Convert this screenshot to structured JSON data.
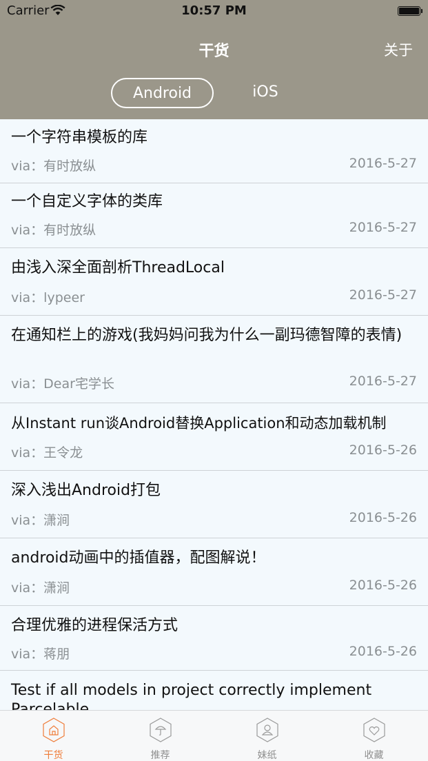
{
  "status_bar": {
    "carrier": "Carrier",
    "time": "10:57 PM"
  },
  "nav": {
    "title": "干货",
    "about_label": "关于"
  },
  "segments": [
    {
      "label": "Android",
      "selected": true
    },
    {
      "label": "iOS",
      "selected": false
    }
  ],
  "articles": [
    {
      "title": "一个字符串模板的库",
      "via": "via：有时放纵",
      "date": "2016-5-27"
    },
    {
      "title": "一个自定义字体的类库",
      "via": "via：有时放纵",
      "date": "2016-5-27"
    },
    {
      "title": "由浅入深全面剖析ThreadLocal",
      "via": "via：lypeer",
      "date": "2016-5-27"
    },
    {
      "title": "在通知栏上的游戏(我妈妈问我为什么一副玛德智障的表情)",
      "via": "via：Dear宅学长",
      "date": "2016-5-27"
    },
    {
      "title": "从Instant run谈Android替换Application和动态加载机制",
      "via": "via：王令龙",
      "date": "2016-5-26"
    },
    {
      "title": "深入浅出Android打包",
      "via": "via：潇涧",
      "date": "2016-5-26"
    },
    {
      "title": "android动画中的插值器，配图解说！",
      "via": "via：潇涧",
      "date": "2016-5-26"
    },
    {
      "title": "合理优雅的进程保活方式",
      "via": "via：蒋朋",
      "date": "2016-5-26"
    },
    {
      "title": "Test if all models in project correctly implement Parcelable",
      "via": "",
      "date": ""
    }
  ],
  "tabs": [
    {
      "label": "干货",
      "icon": "home-icon",
      "active": true
    },
    {
      "label": "推荐",
      "icon": "umbrella-icon",
      "active": false
    },
    {
      "label": "妹纸",
      "icon": "person-icon",
      "active": false
    },
    {
      "label": "收藏",
      "icon": "heart-icon",
      "active": false
    }
  ],
  "colors": {
    "header": "#9b978a",
    "accent": "#ef7d3a",
    "list_bg": "#f3f9fd"
  }
}
